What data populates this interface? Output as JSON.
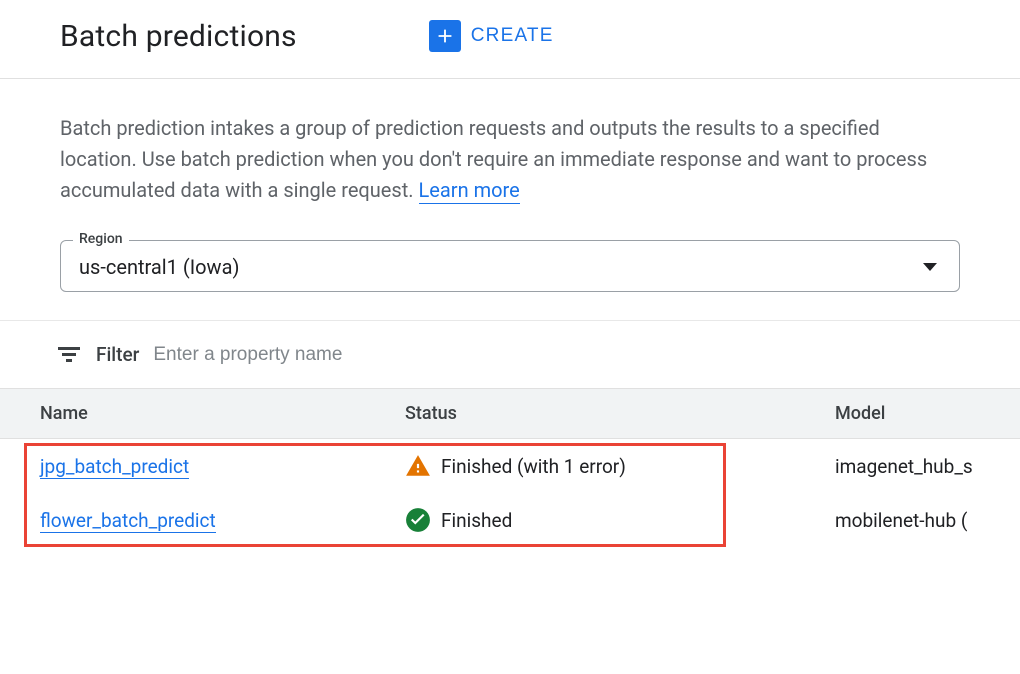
{
  "header": {
    "title": "Batch predictions",
    "create_label": "CREATE"
  },
  "description": {
    "text": "Batch prediction intakes a group of prediction requests and outputs the results to a specified location. Use batch prediction when you don't require an immediate response and want to process accumulated data with a single request.",
    "learn_more": "Learn more"
  },
  "region": {
    "label": "Region",
    "value": "us-central1 (Iowa)"
  },
  "filter": {
    "label": "Filter",
    "placeholder": "Enter a property name"
  },
  "table": {
    "columns": {
      "name": "Name",
      "status": "Status",
      "model": "Model"
    },
    "rows": [
      {
        "name": "jpg_batch_predict",
        "status_type": "warning",
        "status_text": "Finished (with 1 error)",
        "model": "imagenet_hub_s"
      },
      {
        "name": "flower_batch_predict",
        "status_type": "success",
        "status_text": "Finished",
        "model": "mobilenet-hub ("
      }
    ]
  }
}
